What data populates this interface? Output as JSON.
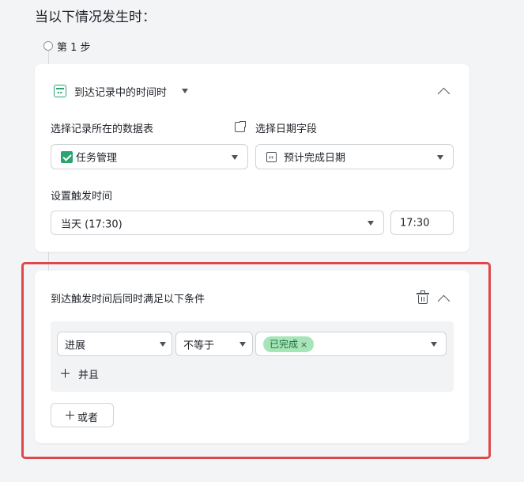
{
  "heading": "当以下情况发生时：",
  "step": {
    "label": "第 1 步"
  },
  "trigger_card": {
    "trigger_type": {
      "label": "到达记录中的时间时",
      "icon": "calendar-grid-icon",
      "icon_color": "#2ba471"
    },
    "table_select": {
      "label": "选择记录所在的数据表",
      "value": "任务管理",
      "icon": "checkbox-checked-icon"
    },
    "date_field": {
      "label": "选择日期字段",
      "value": "预计完成日期",
      "label_icon": "external-link-icon",
      "value_icon": "calendar-icon"
    },
    "trigger_time": {
      "label": "设置触发时间",
      "day_value": "当天 (17:30)",
      "time_value": "17:30"
    }
  },
  "condition_card": {
    "title": "到达触发时间后同时满足以下条件",
    "condition": {
      "field": "进展",
      "operator": "不等于",
      "value_tag": "已完成",
      "tag_color": "#a5e5b8"
    },
    "and_button": "并且",
    "or_button": "或者"
  },
  "colors": {
    "accent_green": "#2ba471",
    "highlight_border": "#e0464a",
    "background": "#f3f4f6"
  }
}
